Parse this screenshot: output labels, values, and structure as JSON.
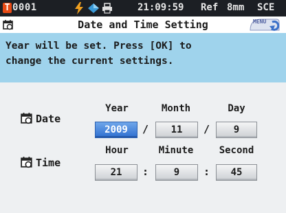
{
  "status": {
    "badge": "T",
    "code": "0001",
    "time": "21:09:59",
    "ref": "Ref",
    "aperture": "8mm",
    "mode": "SCE"
  },
  "title": "Date and Time Setting",
  "menu_label": "MENU",
  "message": "Year will be set. Press [OK] to\nchange the current settings.",
  "date": {
    "label": "Date",
    "headers": [
      "Year",
      "Month",
      "Day"
    ],
    "values": [
      "2009",
      "11",
      "9"
    ],
    "separator": "/"
  },
  "time": {
    "label": "Time",
    "headers": [
      "Hour",
      "Minute",
      "Second"
    ],
    "values": [
      "21",
      "9",
      "45"
    ],
    "separator": ":"
  },
  "colors": {
    "status_bg": "#1c1f24",
    "message_bg": "#9fd3ec",
    "selected_field": "#2f6fd0",
    "badge": "#e84a14"
  },
  "icons": [
    "bolt-icon",
    "diamond-icon",
    "printer-icon",
    "calendar-icon",
    "menu-icon"
  ]
}
